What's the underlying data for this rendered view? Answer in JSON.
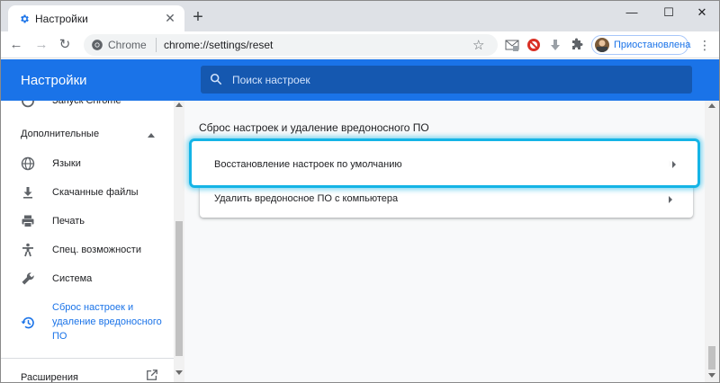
{
  "tab": {
    "title": "Настройки",
    "favicon": "gear-icon"
  },
  "omnibox": {
    "scheme_label": "Chrome",
    "url": "chrome://settings/reset"
  },
  "profile": {
    "label": "Приостановлена"
  },
  "header": {
    "title": "Настройки",
    "search_placeholder": "Поиск настроек"
  },
  "sidebar": {
    "partial_item": "Запуск Chrome",
    "section_label": "Дополнительные",
    "items": [
      {
        "label": "Языки",
        "icon": "globe-icon"
      },
      {
        "label": "Скачанные файлы",
        "icon": "download-icon"
      },
      {
        "label": "Печать",
        "icon": "printer-icon"
      },
      {
        "label": "Спец. возможности",
        "icon": "accessibility-icon"
      },
      {
        "label": "Система",
        "icon": "wrench-icon"
      },
      {
        "label": "Сброс настроек и\nудаление вредоносного\nПО",
        "icon": "history-reset-icon",
        "active": true
      }
    ],
    "extensions_label": "Расширения"
  },
  "main": {
    "section_title": "Сброс настроек и удаление вредоносного ПО",
    "rows": [
      {
        "label": "Восстановление настроек по умолчанию",
        "highlighted": true
      },
      {
        "label": "Удалить вредоносное ПО с компьютера"
      }
    ]
  },
  "colors": {
    "accent": "#1a73e8",
    "highlight": "#14b4e6",
    "active_text": "#1a73e8"
  }
}
